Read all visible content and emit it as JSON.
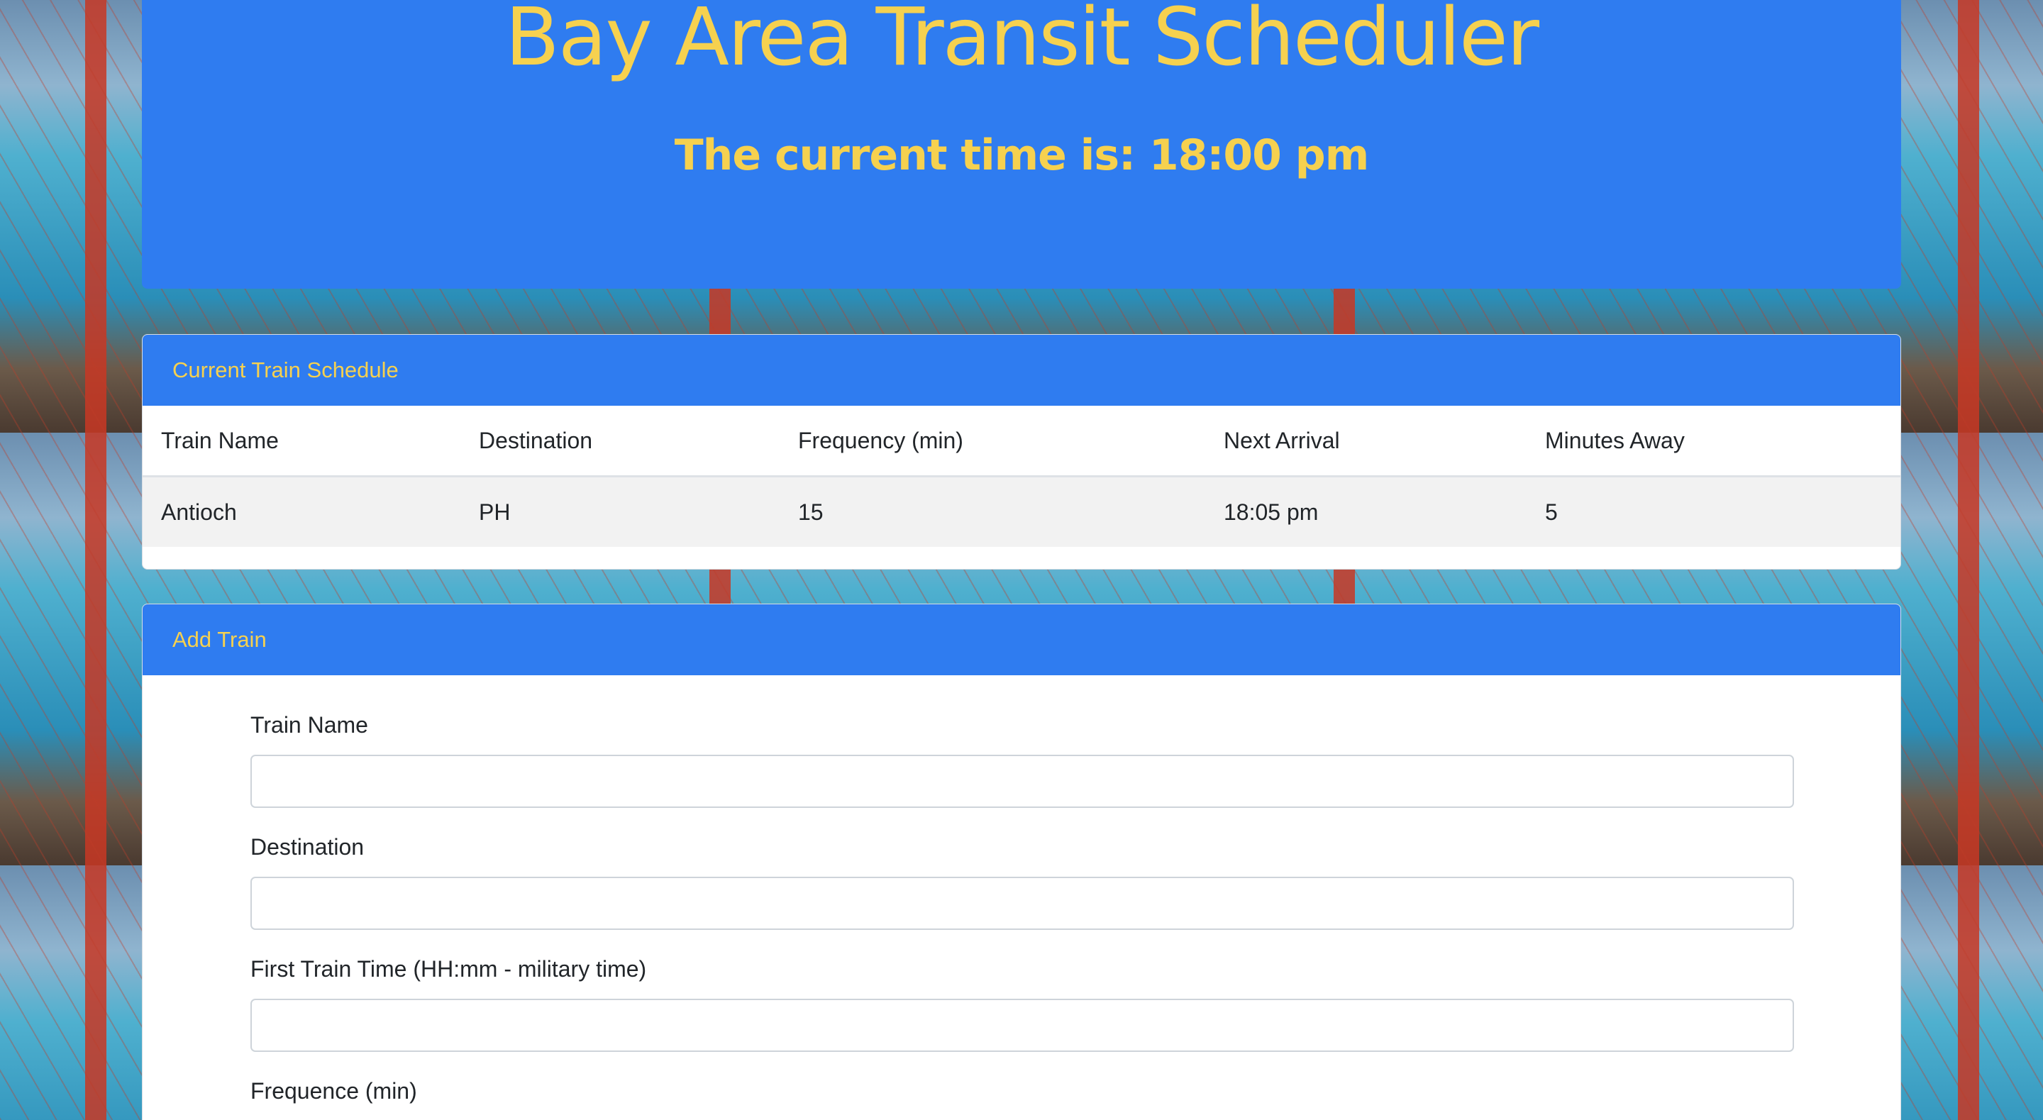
{
  "header": {
    "title": "Bay Area Transit Scheduler",
    "current_time_label": "The current time is: 18:00 pm"
  },
  "schedule": {
    "title": "Current Train Schedule",
    "columns": [
      "Train Name",
      "Destination",
      "Frequency (min)",
      "Next Arrival",
      "Minutes Away"
    ],
    "rows": [
      [
        "Antioch",
        "PH",
        "15",
        "18:05 pm",
        "5"
      ]
    ]
  },
  "add_train": {
    "title": "Add Train",
    "fields": [
      {
        "label": "Train Name",
        "value": "",
        "placeholder": ""
      },
      {
        "label": "Destination",
        "value": "",
        "placeholder": ""
      },
      {
        "label": "First Train Time (HH:mm - military time)",
        "value": "",
        "placeholder": ""
      },
      {
        "label": "Frequence (min)",
        "value": "",
        "placeholder": ""
      }
    ]
  },
  "colors": {
    "primary": "#2f7cf0",
    "accent_text": "#f6d14f",
    "row_stripe": "#f2f2f2"
  }
}
